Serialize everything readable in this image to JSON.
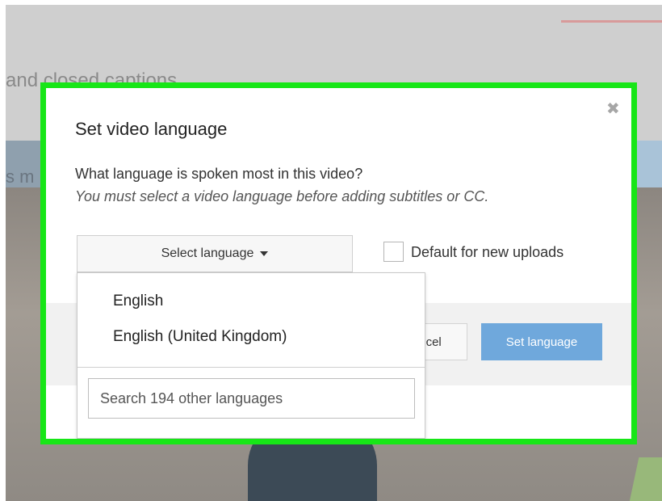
{
  "background": {
    "heading_fragment": "and closed captions",
    "band_fragment": "s m"
  },
  "dialog": {
    "close_icon": "close-icon",
    "title": "Set video language",
    "question": "What language is spoken most in this video?",
    "note": "You must select a video language before adding subtitles or CC.",
    "select_label": "Select language",
    "default_checkbox_label": "Default for new uploads",
    "default_checked": false,
    "cancel_label": "ncel",
    "set_language_label": "Set language"
  },
  "dropdown": {
    "options": [
      "English",
      "English (United Kingdom)"
    ],
    "search_placeholder": "Search 194 other languages"
  },
  "colors": {
    "highlight": "#17e617",
    "primary_button": "#6fa8dc"
  }
}
